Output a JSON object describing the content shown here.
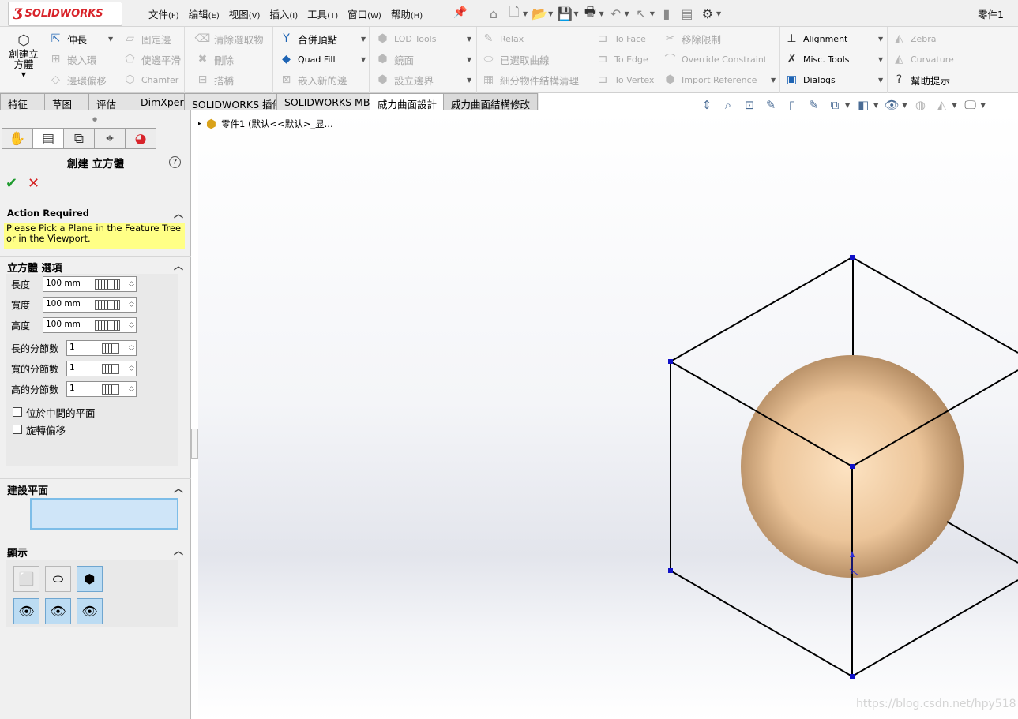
{
  "app": {
    "brand_ds": "Ʒ",
    "brand_name": "SOLIDWORKS",
    "doc_title": "零件1"
  },
  "menu": [
    {
      "label": "文件",
      "key": "(F)"
    },
    {
      "label": "编辑",
      "key": "(E)"
    },
    {
      "label": "视图",
      "key": "(V)"
    },
    {
      "label": "插入",
      "key": "(I)"
    },
    {
      "label": "工具",
      "key": "(T)"
    },
    {
      "label": "窗口",
      "key": "(W)"
    },
    {
      "label": "帮助",
      "key": "(H)"
    }
  ],
  "ribbon": {
    "create_cube": "創建立方體",
    "extend": "伸長",
    "fix_edge": "固定邊",
    "embed_loop": "嵌入環",
    "edge_loop_offset": "邊環偏移",
    "clear_selection": "清除選取物",
    "smooth_edge": "使邊平滑",
    "chamfer": "Chamfer",
    "delete": "刪除",
    "bridge": "搭橋",
    "merge_vertex": "合併頂點",
    "quad_fill": "Quad Fill",
    "embed_new_edge": "嵌入新的邊",
    "lod_tools": "LOD Tools",
    "mirror": "鏡面",
    "set_boundary": "設立邊界",
    "relax": "Relax",
    "selected_curves": "已選取曲線",
    "subdivide_cleanup": "細分物件結構清理",
    "to_face": "To Face",
    "to_edge": "To Edge",
    "to_vertex": "To Vertex",
    "remove_constraint": "移除限制",
    "override_constraint": "Override Constraint",
    "import_reference": "Import Reference",
    "alignment": "Alignment",
    "misc_tools": "Misc. Tools",
    "dialogs": "Dialogs",
    "zebra": "Zebra",
    "curvature": "Curvature",
    "help_hint": "幫助提示"
  },
  "tabs": [
    "特征",
    "草图",
    "评估",
    "DimXpert",
    "SOLIDWORKS 插件",
    "SOLIDWORKS MBD",
    "威力曲面設計",
    "威力曲面結構修改"
  ],
  "tree": {
    "root": "零件1  (默认<<默认>_显..."
  },
  "panel": {
    "title": "創建 立方體",
    "action_required": "Action Required",
    "message": "Please Pick a Plane in the Feature Tree or in the Viewport.",
    "options_header": "立方體 選項",
    "fields": [
      {
        "label": "長度",
        "value": "100 mm"
      },
      {
        "label": "寬度",
        "value": "100 mm"
      },
      {
        "label": "高度",
        "value": "100 mm"
      },
      {
        "label": "長的分節數",
        "value": "1"
      },
      {
        "label": "寬的分節數",
        "value": "1"
      },
      {
        "label": "高的分節數",
        "value": "1"
      }
    ],
    "center_plane": "位於中間的平面",
    "rotate_offset": "旋轉偏移",
    "plane_header": "建設平面",
    "display_header": "顯示"
  },
  "watermark": "https://blog.csdn.net/hpy518",
  "colors": {
    "accent": "#1e64b4",
    "sphere": "#e9c9a0",
    "message_bg": "#ffff86",
    "ok": "#1f9b2f",
    "cancel": "#d42020",
    "vertex": "#1010c8"
  }
}
